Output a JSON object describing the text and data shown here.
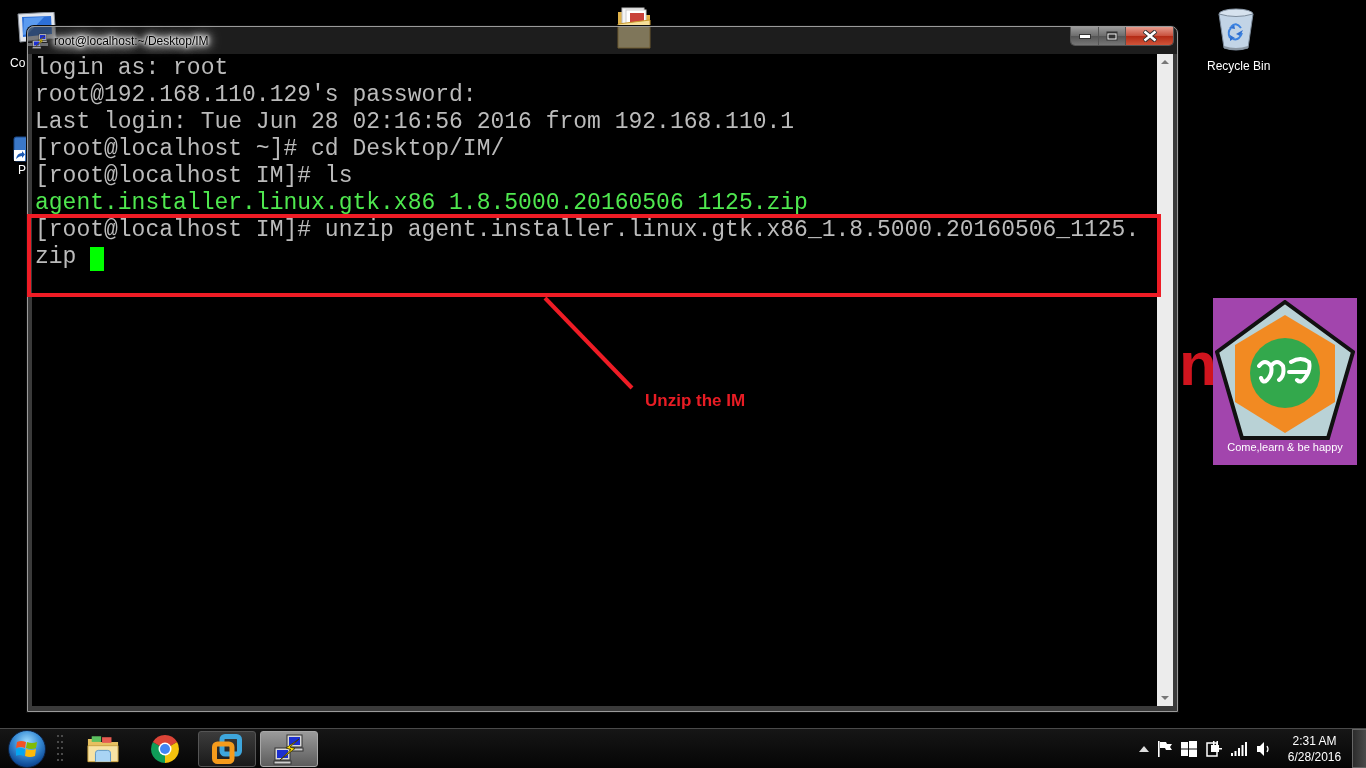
{
  "desktop": {
    "icons": [
      {
        "kind": "computer",
        "label": "Co"
      },
      {
        "kind": "shortcut",
        "label": "P"
      },
      {
        "kind": "folder"
      },
      {
        "kind": "recycle-bin",
        "label": "Recycle Bin"
      }
    ],
    "wallpaper_text": "n",
    "logo": {
      "caption": "Come,learn & be happy"
    }
  },
  "window": {
    "title": "root@localhost:~/Desktop/IM",
    "terminal": {
      "lines": [
        {
          "text": "login as: root",
          "color": "#bbbbbb",
          "cursor": false
        },
        {
          "text": "root@192.168.110.129's password:",
          "color": "#bbbbbb",
          "cursor": false
        },
        {
          "text": "Last login: Tue Jun 28 02:16:56 2016 from 192.168.110.1",
          "color": "#bbbbbb",
          "cursor": false
        },
        {
          "text": "[root@localhost ~]# cd Desktop/IM/",
          "color": "#bbbbbb",
          "cursor": false
        },
        {
          "text": "[root@localhost IM]# ls",
          "color": "#bbbbbb",
          "cursor": false
        },
        {
          "text": "agent.installer.linux.gtk.x86 1.8.5000.20160506 1125.zip",
          "color": "#4fe84f",
          "cursor": false
        },
        {
          "text": "[root@localhost IM]# unzip agent.installer.linux.gtk.x86_1.8.5000.20160506_1125.",
          "color": "#bbbbbb",
          "cursor": false
        },
        {
          "text": "zip",
          "color": "#bbbbbb",
          "cursor": true
        }
      ]
    }
  },
  "annotation": {
    "label": "Unzip the IM"
  },
  "taskbar": {
    "apps": [
      {
        "kind": "folder",
        "running": false,
        "selected": false
      },
      {
        "kind": "browser",
        "running": false,
        "selected": false
      },
      {
        "kind": "vm",
        "running": true,
        "selected": false
      },
      {
        "kind": "terminal",
        "running": true,
        "selected": true
      }
    ],
    "clock": {
      "time": "2:31 AM",
      "date": "6/28/2016"
    }
  }
}
